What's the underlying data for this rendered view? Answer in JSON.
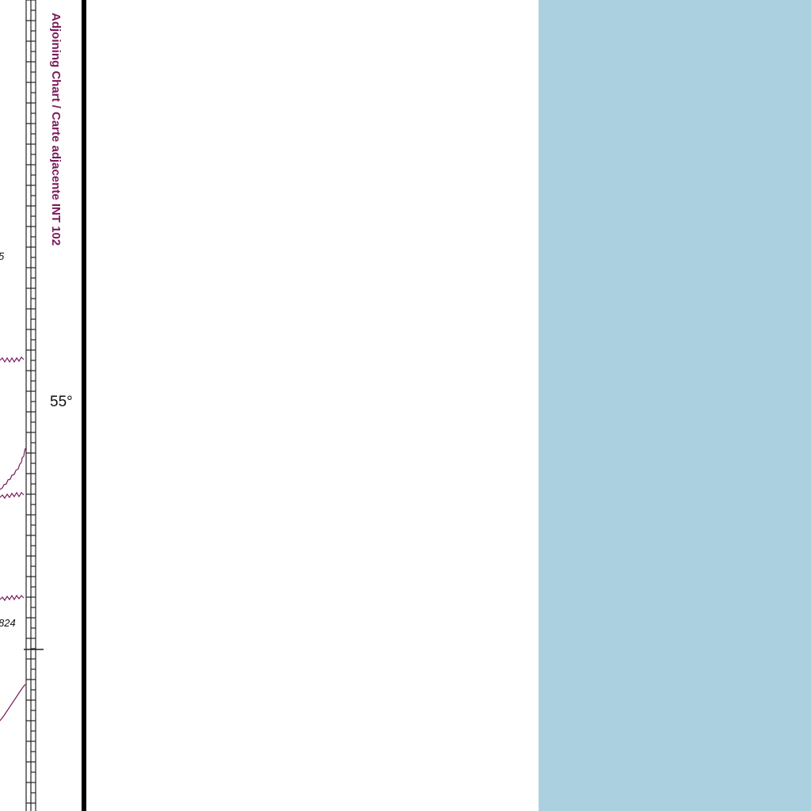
{
  "map": {
    "adjoining_chart_label": "Adjoining Chart / Carte adjacente  INT 102",
    "latitude_label": "55°",
    "soundings": [
      "5",
      "824"
    ],
    "colors": {
      "paper": "#ffffff",
      "sea_tint": "#abd1e0",
      "border": "#000000",
      "limit_lines": "#7a1a5a",
      "scale_lines": "#222222"
    }
  }
}
